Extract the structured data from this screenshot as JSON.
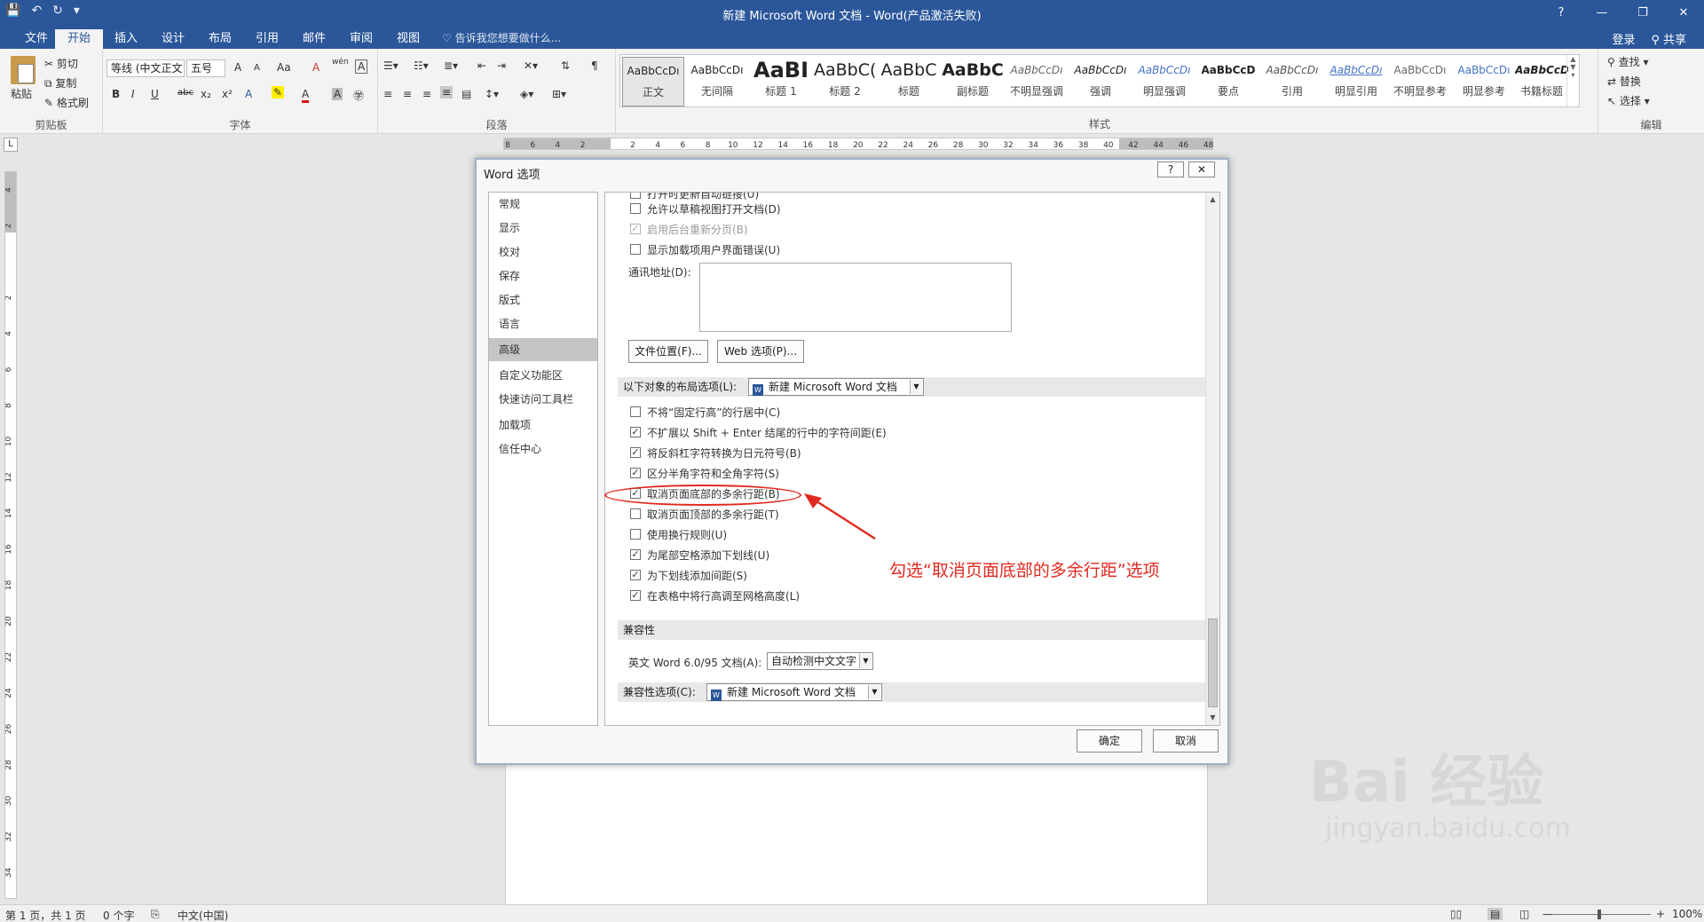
{
  "window": {
    "title": "新建 Microsoft Word 文档 - Word(产品激活失败)",
    "controls": [
      "?",
      "—",
      "❐",
      "✕"
    ]
  },
  "qat": {
    "save": "💾",
    "undo": "↶",
    "redo": "↻",
    "more": "▾"
  },
  "tabs": [
    "文件",
    "开始",
    "插入",
    "设计",
    "布局",
    "引用",
    "邮件",
    "审阅",
    "视图"
  ],
  "tell_me": "告诉我您想要做什么...",
  "account": {
    "login": "登录",
    "share": "共享"
  },
  "ribbon": {
    "clipboard": {
      "label": "剪贴板",
      "paste": "粘贴",
      "cut": "剪切",
      "copy": "复制",
      "format_painter": "格式刷"
    },
    "font": {
      "label": "字体",
      "font_name": "等线 (中文正文",
      "font_size": "五号",
      "bold": "B",
      "italic": "I",
      "underline": "U",
      "strike": "abc",
      "sub": "x₂",
      "sup": "x²",
      "grow": "A",
      "shrink": "A",
      "case": "Aa",
      "clear": "A",
      "wen": "wén"
    },
    "paragraph": {
      "label": "段落"
    },
    "styles": {
      "label": "样式",
      "items": [
        {
          "sample": "AaBbCcDı",
          "name": "正文"
        },
        {
          "sample": "AaBbCcDı",
          "name": "无间隔"
        },
        {
          "sample": "AaBI",
          "name": "标题 1"
        },
        {
          "sample": "AaBbC(",
          "name": "标题 2"
        },
        {
          "sample": "AaBbC",
          "name": "标题"
        },
        {
          "sample": "AaBbC",
          "name": "副标题"
        },
        {
          "sample": "AaBbCcDı",
          "name": "不明显强调"
        },
        {
          "sample": "AaBbCcDı",
          "name": "强调"
        },
        {
          "sample": "AaBbCcDı",
          "name": "明显强调"
        },
        {
          "sample": "AaBbCcD",
          "name": "要点"
        },
        {
          "sample": "AaBbCcDı",
          "name": "引用"
        },
        {
          "sample": "AaBbCcDı",
          "name": "明显引用"
        },
        {
          "sample": "AaBbCcDı",
          "name": "不明显参考"
        },
        {
          "sample": "AaBbCcDı",
          "name": "明显参考"
        },
        {
          "sample": "AaBbCcD",
          "name": "书籍标题"
        }
      ]
    },
    "editing": {
      "label": "编辑",
      "find": "查找",
      "replace": "替换",
      "select": "选择"
    }
  },
  "ruler": {
    "h_ticks": [
      "8",
      "6",
      "4",
      "2",
      "",
      "2",
      "4",
      "6",
      "8",
      "10",
      "12",
      "14",
      "16",
      "18",
      "20",
      "22",
      "24",
      "26",
      "28",
      "30",
      "32",
      "34",
      "36",
      "38",
      "40",
      "42",
      "44",
      "46",
      "48"
    ],
    "v_ticks": [
      "4",
      "2",
      "",
      "2",
      "4",
      "6",
      "8",
      "10",
      "12",
      "14",
      "16",
      "18",
      "20",
      "22",
      "24",
      "26",
      "28",
      "30",
      "32",
      "34"
    ]
  },
  "dialog": {
    "title": "Word 选项",
    "help": "?",
    "close": "✕",
    "nav": [
      "常规",
      "显示",
      "校对",
      "保存",
      "版式",
      "语言",
      "高级",
      "自定义功能区",
      "快速访问工具栏",
      "加载项",
      "信任中心"
    ],
    "active_nav": "高级",
    "top_options": [
      {
        "label": "打开时更新自动链接(U)",
        "checked": false,
        "disabled": false
      },
      {
        "label": "允许以草稿视图打开文档(D)",
        "checked": false,
        "disabled": false
      },
      {
        "label": "启用后台重新分页(B)",
        "checked": true,
        "disabled": true
      },
      {
        "label": "显示加载项用户界面错误(U)",
        "checked": false,
        "disabled": false
      }
    ],
    "mail_address_label": "通讯地址(D):",
    "file_locations_btn": "文件位置(F)...",
    "web_options_btn": "Web 选项(P)...",
    "layout_section_label": "以下对象的布局选项(L):",
    "layout_doc": "新建 Microsoft Word 文档",
    "layout_options": [
      {
        "label": "不将“固定行高”的行居中(C)",
        "checked": false
      },
      {
        "label": "不扩展以 Shift + Enter 结尾的行中的字符间距(E)",
        "checked": true
      },
      {
        "label": "将反斜杠字符转换为日元符号(B)",
        "checked": true
      },
      {
        "label": "区分半角字符和全角字符(S)",
        "checked": true
      },
      {
        "label": "取消页面底部的多余行距(B)",
        "checked": true
      },
      {
        "label": "取消页面顶部的多余行距(T)",
        "checked": false
      },
      {
        "label": "使用换行规则(U)",
        "checked": false
      },
      {
        "label": "为尾部空格添加下划线(U)",
        "checked": true
      },
      {
        "label": "为下划线添加间距(S)",
        "checked": true
      },
      {
        "label": "在表格中将行高调至网格高度(L)",
        "checked": true
      }
    ],
    "compat_section_label": "兼容性",
    "word6_label": "英文 Word 6.0/95 文档(A):",
    "word6_value": "自动检测中文文字",
    "compat_options_label": "兼容性选项(C):",
    "compat_doc": "新建 Microsoft Word 文档",
    "ok": "确定",
    "cancel": "取消"
  },
  "annotation": "勾选“取消页面底部的多余行距”选项",
  "status": {
    "page": "第 1 页，共 1 页",
    "words": "0 个字",
    "lang": "中文(中国)",
    "zoom": "100%",
    "zoom_minus": "—",
    "zoom_plus": "+"
  },
  "watermark": {
    "logo": "Bai 经验",
    "url": "jingyan.baidu.com"
  },
  "colors": {
    "word_blue": "#2b579a",
    "annotation_red": "#e02a20"
  }
}
